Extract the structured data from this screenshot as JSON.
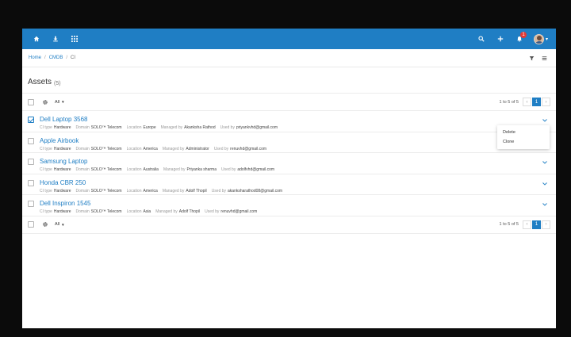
{
  "header": {
    "notification_count": "1",
    "colors": {
      "brand": "#1f7ec4",
      "badge": "#e53935"
    },
    "left_icons": [
      "home-icon",
      "download-icon",
      "apps-grid-icon"
    ],
    "right_icons": [
      "search-icon",
      "plus-icon",
      "bell-icon"
    ]
  },
  "breadcrumb": {
    "home": "Home",
    "sep": "/",
    "cmdb": "CMDB",
    "current": "CI"
  },
  "page": {
    "title": "Assets",
    "count": "(5)"
  },
  "toolbar": {
    "filter_label": "All",
    "range": "1 to 5 of 5",
    "prev": "‹",
    "page": "1",
    "next": "›"
  },
  "labels": {
    "ci_type": "CI type",
    "domain": "Domain",
    "location": "Location",
    "managed_by": "Managed by",
    "used_by": "Used by"
  },
  "assets": [
    {
      "name": "Dell Laptop 3568",
      "ci_type": "Hardware",
      "domain": "SOLO™ Telecom",
      "location": "Europe",
      "managed_by": "Akanksha Rathod",
      "used_by": "priyankvhd@gmail.com",
      "checked": true
    },
    {
      "name": "Apple Airbook",
      "ci_type": "Hardware",
      "domain": "SOLO™ Telecom",
      "location": "America",
      "managed_by": "Administrator",
      "used_by": "renuvhd@gmail.com",
      "checked": false
    },
    {
      "name": "Samsung Laptop",
      "ci_type": "Hardware",
      "domain": "SOLO™ Telecom",
      "location": "Australia",
      "managed_by": "Priyanka sharma",
      "used_by": "adolfvhd@gmail.com",
      "checked": false
    },
    {
      "name": "Honda CBR 250",
      "ci_type": "Hardware",
      "domain": "SOLO™ Telecom",
      "location": "America",
      "managed_by": "Adolf Thopil",
      "used_by": "akanksharathod08@gmail.com",
      "checked": false
    },
    {
      "name": "Dell Inspiron 1545",
      "ci_type": "Hardware",
      "domain": "SOLO™ Telecom",
      "location": "Asia",
      "managed_by": "Adolf Thopil",
      "used_by": "renuvhd@gmail.com",
      "checked": false
    }
  ],
  "row_menu": {
    "delete": "Delete",
    "clone": "Clone"
  }
}
